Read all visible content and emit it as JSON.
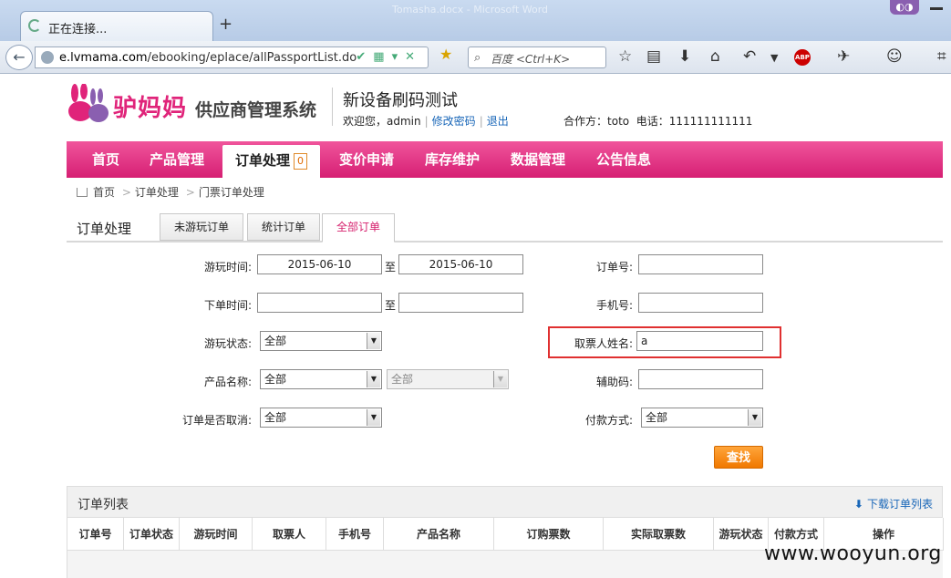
{
  "browser": {
    "tab_title": "正在连接...",
    "new_tab": "+",
    "background_title": "Tomasha.docx - Microsoft Word",
    "url_host": "e.lvmama.com",
    "url_path": "/ebooking/eplace/allPassportList.do",
    "search_placeholder": "百度 <Ctrl+K>"
  },
  "header": {
    "logo_text": "驴妈妈",
    "logo_subtitle": "供应商管理系统",
    "system_title": "新设备刷码测试",
    "welcome_label": "欢迎您，",
    "username": "admin",
    "change_password": "修改密码",
    "logout": "退出",
    "partner_label": "合作方：",
    "partner_name": "toto",
    "phone_label": "电话：",
    "phone": "111111111111"
  },
  "nav": {
    "home": "首页",
    "products": "产品管理",
    "orders": "订单处理",
    "orders_badge": "0",
    "price_change": "变价申请",
    "inventory": "库存维护",
    "data": "数据管理",
    "notices": "公告信息"
  },
  "breadcrumb": {
    "home": "首页",
    "orders": "订单处理",
    "ticket_orders": "门票订单处理",
    "sep": ">"
  },
  "section": {
    "title": "订单处理",
    "tabs": [
      "未游玩订单",
      "统计订单",
      "全部订单"
    ]
  },
  "form": {
    "play_time_label": "游玩时间:",
    "play_time_from": "2015-06-10",
    "play_time_to": "2015-06-10",
    "to_label": "至",
    "order_time_label": "下单时间:",
    "order_time_from": "",
    "order_time_to": "",
    "play_status_label": "游玩状态:",
    "play_status_value": "全部",
    "product_name_label": "产品名称:",
    "product_name_value": "全部",
    "product_sub_value": "全部",
    "cancelled_label": "订单是否取消:",
    "cancelled_value": "全部",
    "order_no_label": "订单号:",
    "order_no_value": "",
    "phone_label": "手机号:",
    "phone_value": "",
    "ticket_holder_label": "取票人姓名:",
    "ticket_holder_value": "a",
    "aux_code_label": "辅助码:",
    "aux_code_value": "",
    "payment_label": "付款方式:",
    "payment_value": "全部",
    "find_button": "查找"
  },
  "order_list": {
    "title": "订单列表",
    "download": "下载订单列表",
    "columns": [
      "订单号",
      "订单状态",
      "游玩时间",
      "取票人",
      "手机号",
      "产品名称",
      "订购票数",
      "实际取票数",
      "游玩状态",
      "付款方式",
      "操作"
    ]
  },
  "watermark": "www.wooyun.org",
  "colors": {
    "brand_pink": "#e0247a",
    "highlight_red": "#e03030",
    "button_orange": "#f07800",
    "link_blue": "#1866b8"
  }
}
